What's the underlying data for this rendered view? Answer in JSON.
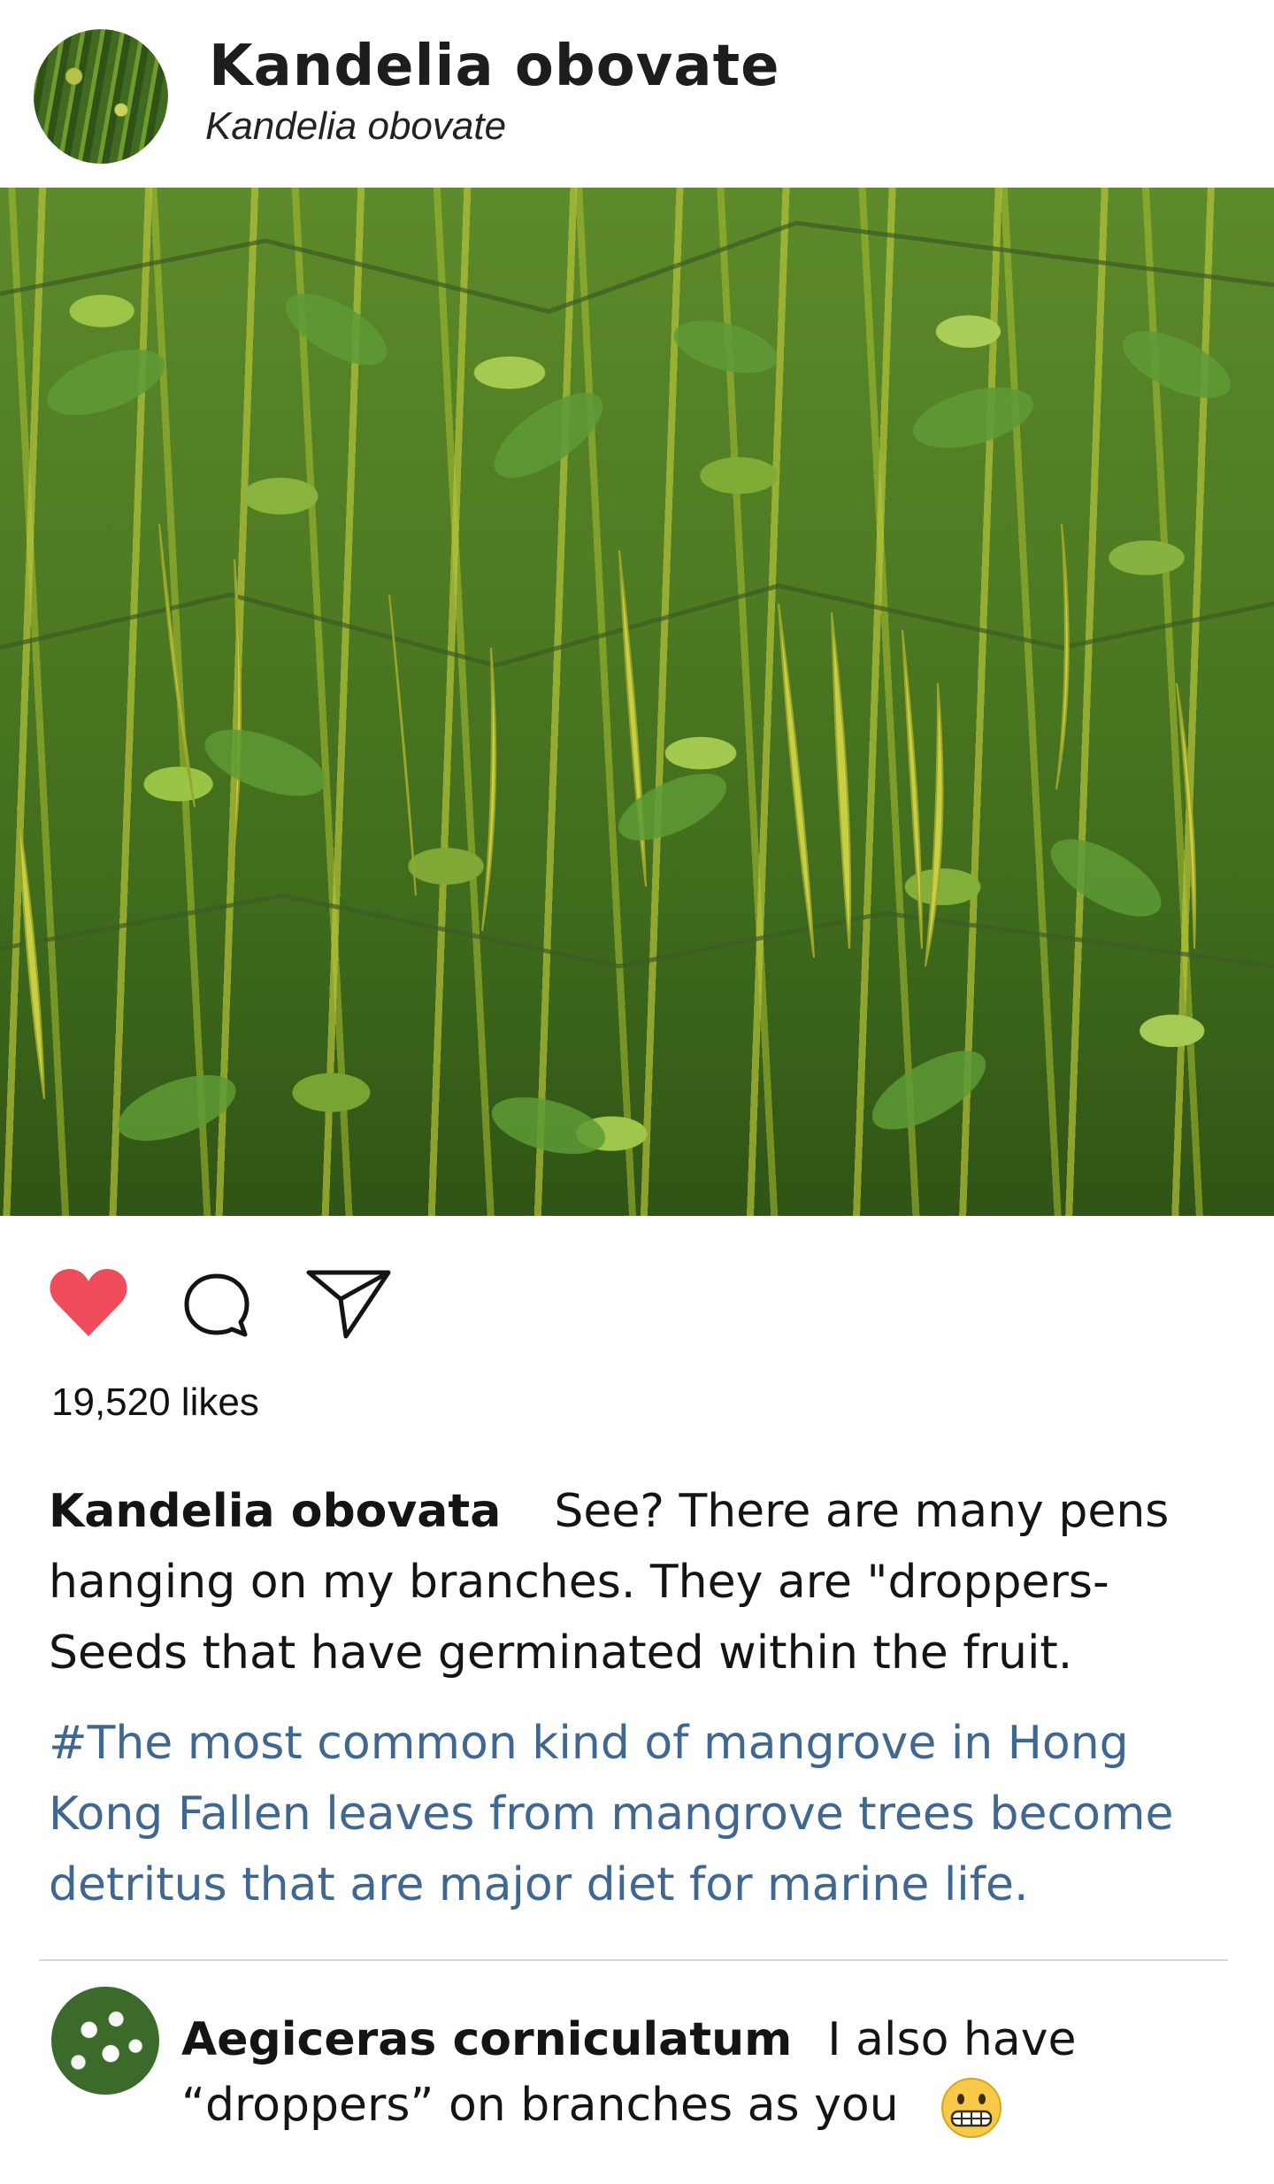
{
  "post": {
    "title": "Kandelia obovate",
    "subtitle": "Kandelia obovate"
  },
  "actions": {
    "like_icon": "heart-icon",
    "comment_icon": "comment-icon",
    "share_icon": "send-icon",
    "like_color": "#ee4b5b"
  },
  "likes": "19,520 likes",
  "caption": {
    "author": "Kandelia obovata",
    "text": "See? There are many pens hanging on my branches. They are \"droppers- Seeds that have germinated within the fruit.",
    "hashtags": "#The most common kind of mangrove in Hong Kong Fallen leaves from mangrove trees become detritus that are major diet for marine life.",
    "hashtag_color": "#3f6791"
  },
  "comment": {
    "author": "Aegiceras corniculatum",
    "text": "I also have “droppers” on branches as you",
    "emoji": "grimacing-face"
  }
}
